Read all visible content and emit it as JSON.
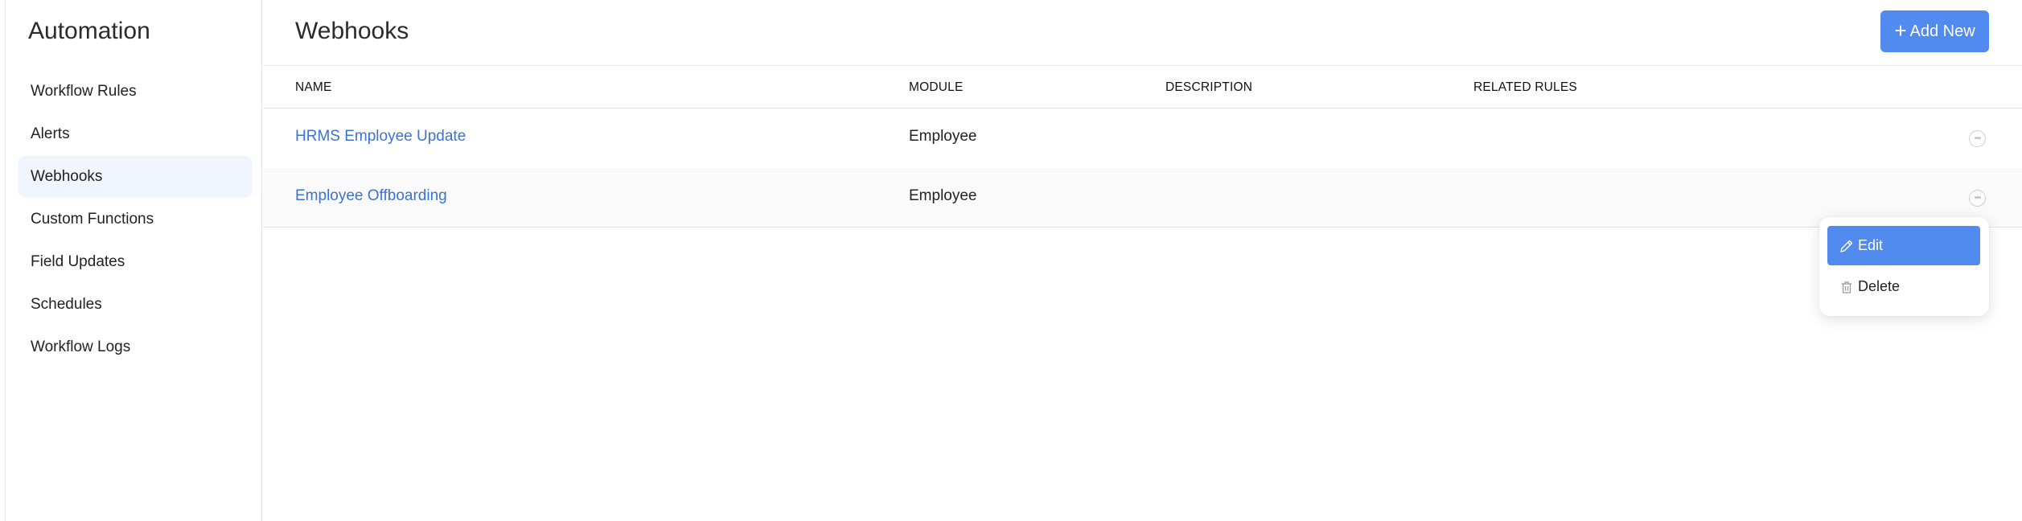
{
  "sidebar": {
    "title": "Automation",
    "items": [
      {
        "label": "Workflow Rules",
        "active": false
      },
      {
        "label": "Alerts",
        "active": false
      },
      {
        "label": "Webhooks",
        "active": true
      },
      {
        "label": "Custom Functions",
        "active": false
      },
      {
        "label": "Field Updates",
        "active": false
      },
      {
        "label": "Schedules",
        "active": false
      },
      {
        "label": "Workflow Logs",
        "active": false
      }
    ]
  },
  "header": {
    "title": "Webhooks",
    "add_button_label": "Add New",
    "add_button_icon": "plus-icon"
  },
  "table": {
    "columns": [
      "NAME",
      "MODULE",
      "DESCRIPTION",
      "RELATED RULES"
    ],
    "rows": [
      {
        "name": "HRMS Employee Update",
        "module": "Employee",
        "description": "",
        "related_rules": "",
        "actions_icon": "more-horizontal-icon"
      },
      {
        "name": "Employee Offboarding",
        "module": "Employee",
        "description": "",
        "related_rules": "",
        "actions_icon": "more-horizontal-icon"
      }
    ]
  },
  "context_menu": {
    "items": [
      {
        "label": "Edit",
        "icon": "pencil-icon",
        "highlighted": true
      },
      {
        "label": "Delete",
        "icon": "trash-icon",
        "highlighted": false
      }
    ]
  },
  "colors": {
    "accent": "#528bf0",
    "link": "#3a73d4",
    "active_nav_bg": "#f0f5fe"
  }
}
